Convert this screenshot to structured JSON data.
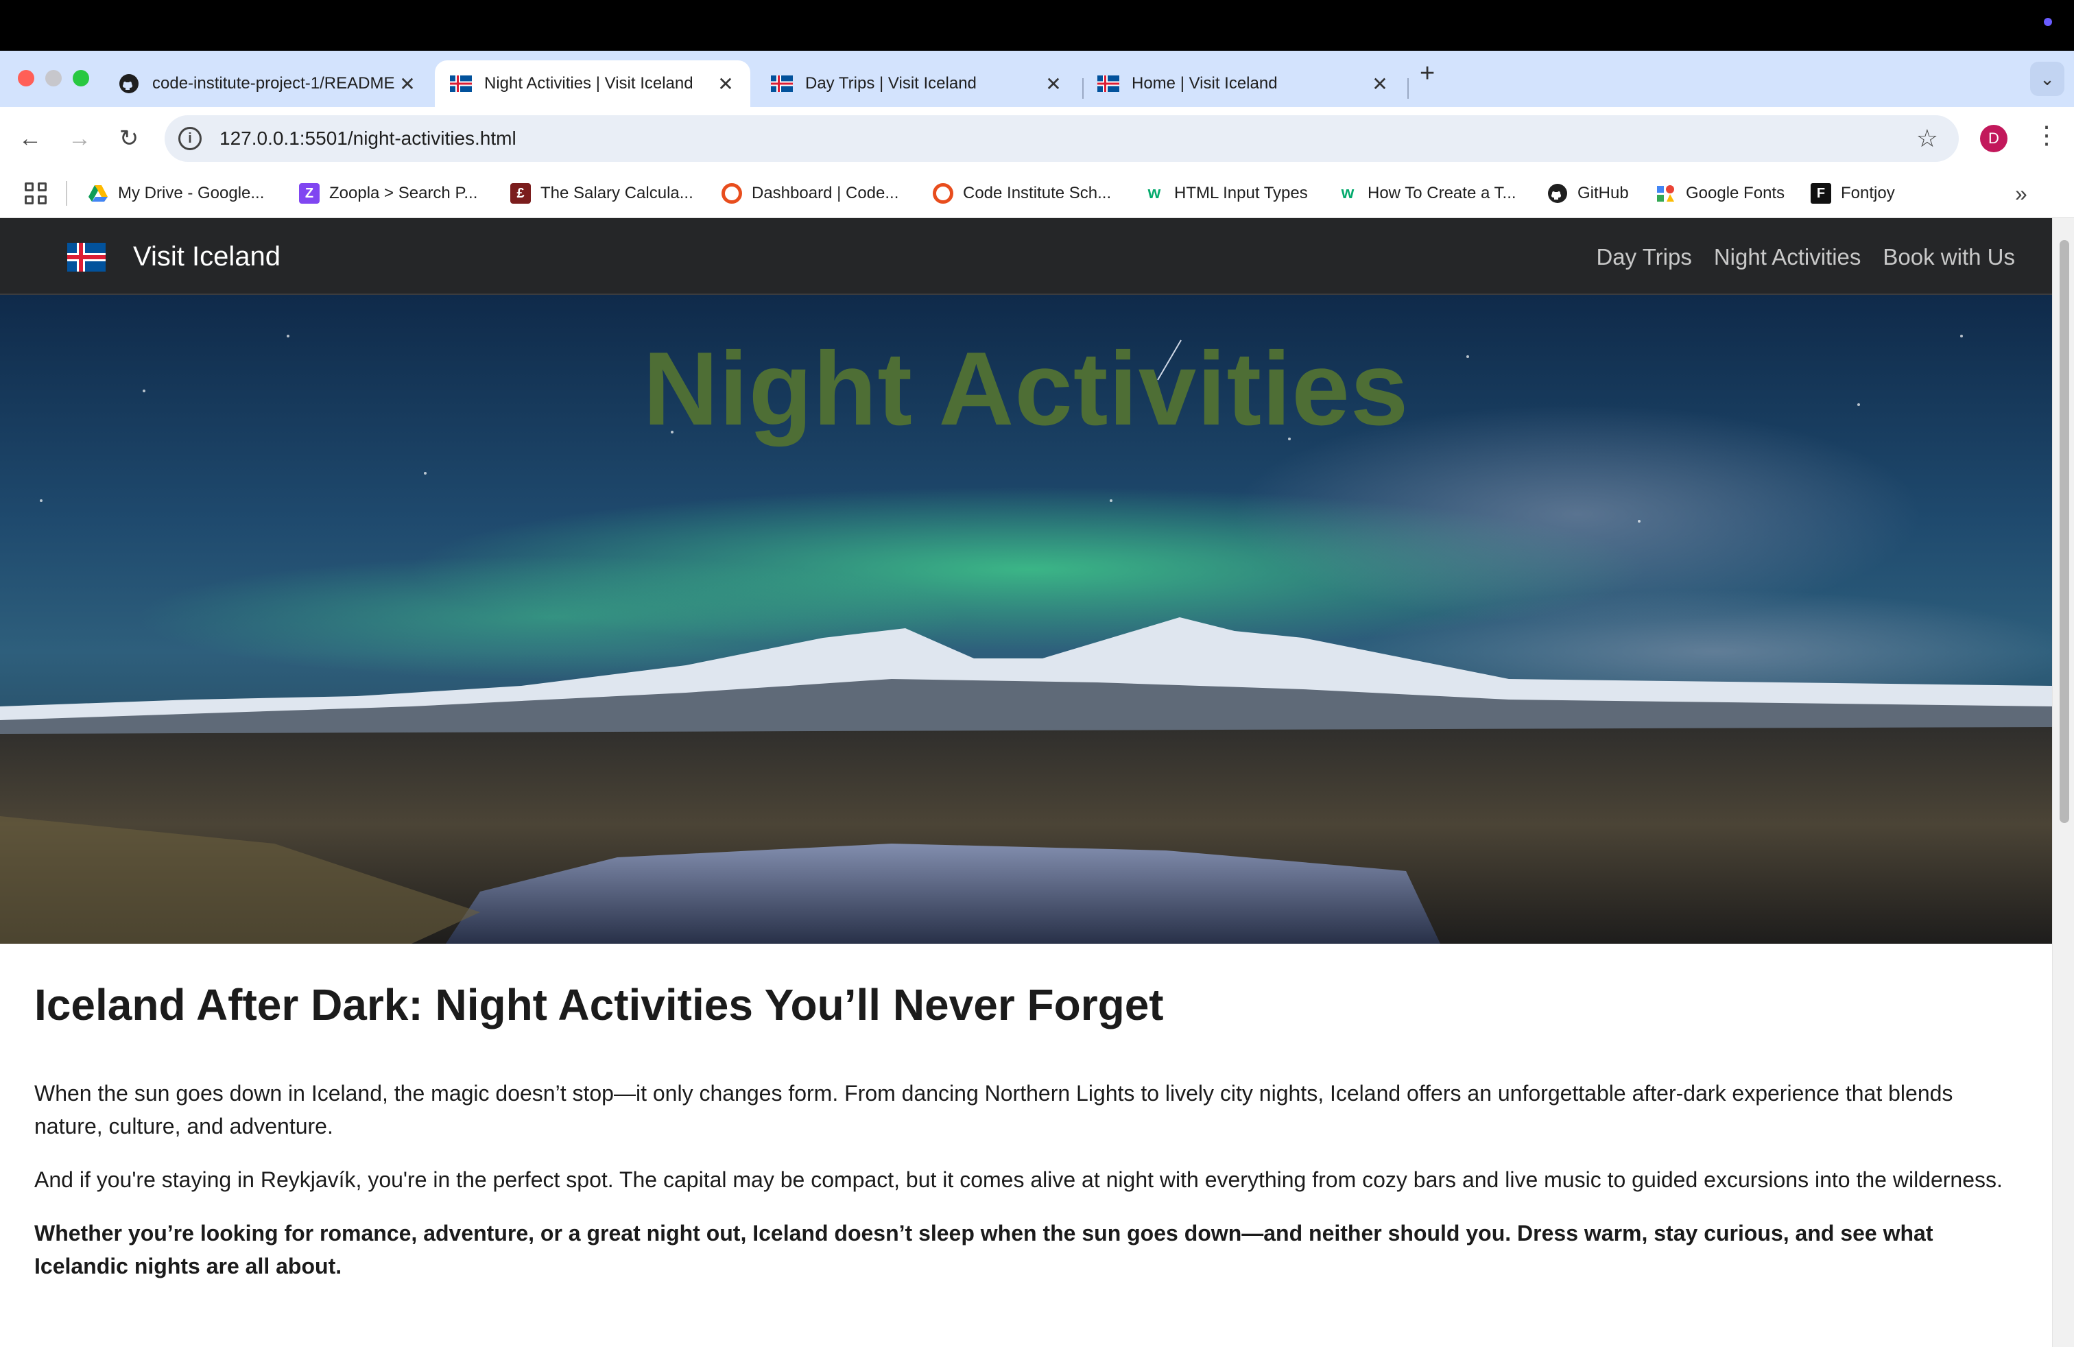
{
  "browser": {
    "tabs": [
      {
        "title": "code-institute-project-1/README",
        "active": false,
        "favicon": "github-icon"
      },
      {
        "title": "Night Activities | Visit Iceland",
        "active": true,
        "favicon": "iceland-flag-icon"
      },
      {
        "title": "Day Trips | Visit Iceland",
        "active": false,
        "favicon": "iceland-flag-icon"
      },
      {
        "title": "Home | Visit Iceland",
        "active": false,
        "favicon": "iceland-flag-icon"
      }
    ],
    "close_glyph": "✕",
    "new_tab_glyph": "+",
    "url": "127.0.0.1:5501/night-activities.html",
    "profile_initial": "D",
    "bookmarks": [
      {
        "label": "My Drive - Google...",
        "icon": "google-drive-icon"
      },
      {
        "label": "Zoopla > Search P...",
        "icon": "zoopla-icon"
      },
      {
        "label": "The Salary Calcula...",
        "icon": "salary-calculator-icon"
      },
      {
        "label": "Dashboard | Code...",
        "icon": "code-institute-icon"
      },
      {
        "label": "Code Institute Sch...",
        "icon": "code-institute-icon"
      },
      {
        "label": "HTML Input Types",
        "icon": "w3schools-icon"
      },
      {
        "label": "How To Create a T...",
        "icon": "w3schools-icon"
      },
      {
        "label": "GitHub",
        "icon": "github-icon"
      },
      {
        "label": "Google Fonts",
        "icon": "google-fonts-icon"
      },
      {
        "label": "Fontjoy",
        "icon": "fontjoy-icon"
      }
    ]
  },
  "site": {
    "brand": "Visit Iceland",
    "nav": [
      "Day Trips",
      "Night Activities",
      "Book with Us"
    ],
    "hero_title": "Night Activities",
    "heading": "Iceland After Dark: Night Activities You’ll Never Forget",
    "paragraphs": [
      "When the sun goes down in Iceland, the magic doesn’t stop—it only changes form. From dancing Northern Lights to lively city nights, Iceland offers an unforgettable after-dark experience that blends nature, culture, and adventure.",
      "And if you're staying in Reykjavík, you're in the perfect spot. The capital may be compact, but it comes alive at night with everything from cozy bars and live music to guided excursions into the wilderness.",
      "Whether you’re looking for romance, adventure, or a great night out, Iceland doesn’t sleep when the sun goes down—and neither should you. Dress warm, stay curious, and see what Icelandic nights are all about."
    ]
  },
  "colors": {
    "tabstrip": "#d3e3fd",
    "navbar": "#252628",
    "hero_title": "#4e6e35"
  }
}
